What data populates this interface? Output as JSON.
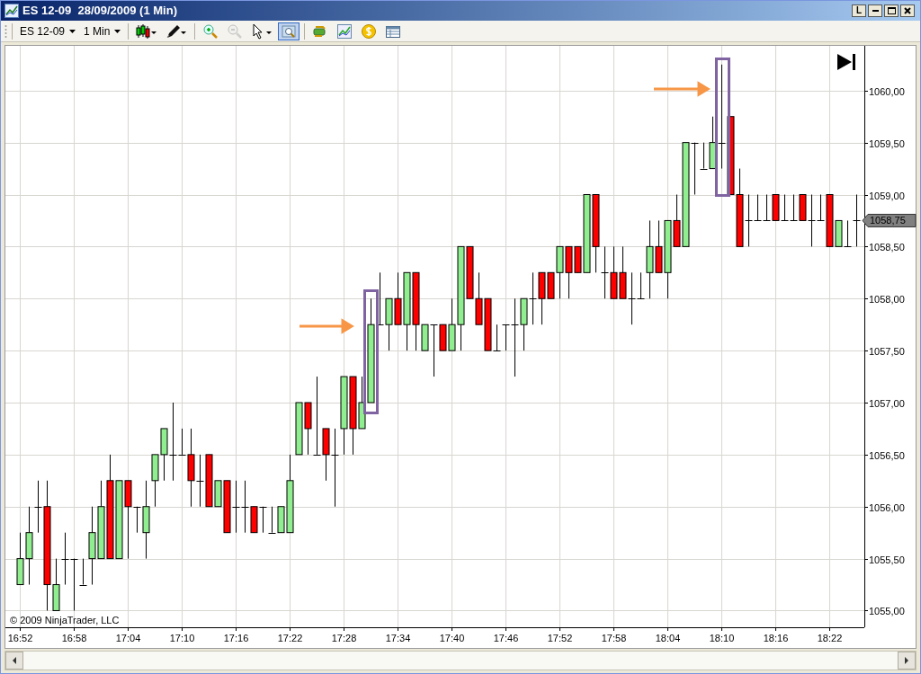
{
  "window": {
    "title": "ES 12-09  28/09/2009 (1 Min)",
    "buttons": [
      "L"
    ]
  },
  "toolbar": {
    "instrument": "ES 12-09",
    "interval": "1 Min",
    "tools": [
      {
        "kind": "bar-style",
        "selected": false,
        "disabled": false
      },
      {
        "kind": "draw",
        "selected": false,
        "disabled": false
      },
      {
        "kind": "zoom-in",
        "selected": false,
        "disabled": false
      },
      {
        "kind": "zoom-out",
        "selected": false,
        "disabled": true
      },
      {
        "kind": "pointer",
        "selected": false,
        "disabled": false
      },
      {
        "kind": "zoom-box",
        "selected": true,
        "disabled": false
      },
      {
        "kind": "data-series",
        "selected": false,
        "disabled": false
      },
      {
        "kind": "chart-style",
        "selected": false,
        "disabled": false
      },
      {
        "kind": "dollar",
        "selected": false,
        "disabled": false
      },
      {
        "kind": "data-box",
        "selected": false,
        "disabled": false
      }
    ]
  },
  "chart": {
    "last_price": "1058,75",
    "copyright": "© 2009 NinjaTrader, LLC",
    "chart_data": {
      "type": "candlestick",
      "grid": true,
      "ylim": [
        1054.84,
        1060.43
      ],
      "categories": [
        "16:52",
        null,
        null,
        null,
        null,
        null,
        "16:58",
        null,
        null,
        null,
        null,
        null,
        "17:04",
        null,
        null,
        null,
        null,
        null,
        "17:10",
        null,
        null,
        null,
        null,
        null,
        "17:16",
        null,
        null,
        null,
        null,
        null,
        "17:22",
        null,
        null,
        null,
        null,
        null,
        "17:28",
        null,
        null,
        null,
        null,
        null,
        "17:34",
        null,
        null,
        null,
        null,
        null,
        "17:40",
        null,
        null,
        null,
        null,
        null,
        "17:46",
        null,
        null,
        null,
        null,
        null,
        "17:52",
        null,
        null,
        null,
        null,
        null,
        "17:58",
        null,
        null,
        null,
        null,
        null,
        "18:04",
        null,
        null,
        null,
        null,
        null,
        "18:10",
        null,
        null,
        null,
        null,
        null,
        "18:16",
        null,
        null,
        null,
        null,
        null,
        "18:22",
        null,
        null,
        null
      ],
      "ohlc": [
        [
          1055.25,
          1055.75,
          1055.25,
          1055.5
        ],
        [
          1055.5,
          1056,
          1055.25,
          1055.75
        ],
        [
          1056,
          1056.25,
          1055.75,
          1056
        ],
        [
          1056,
          1056.25,
          1055,
          1055.25
        ],
        [
          1055,
          1055.5,
          1055,
          1055.25
        ],
        [
          1055.5,
          1055.75,
          1055.25,
          1055.5
        ],
        [
          1055.5,
          1055.5,
          1055,
          1055.5
        ],
        [
          1055.25,
          1055.5,
          1055.25,
          1055.25
        ],
        [
          1055.5,
          1056,
          1055.25,
          1055.75
        ],
        [
          1055.5,
          1056.25,
          1055.5,
          1056
        ],
        [
          1056.25,
          1056.5,
          1055.5,
          1055.5
        ],
        [
          1055.5,
          1056.25,
          1055.5,
          1056.25
        ],
        [
          1056.25,
          1056.25,
          1055.5,
          1056
        ],
        [
          1056,
          1056,
          1055.75,
          1056
        ],
        [
          1055.75,
          1056.25,
          1055.5,
          1056
        ],
        [
          1056.25,
          1056.5,
          1056,
          1056.5
        ],
        [
          1056.5,
          1056.75,
          1056.25,
          1056.75
        ],
        [
          1056.5,
          1057,
          1056.25,
          1056.5
        ],
        [
          1056.5,
          1056.75,
          1056.5,
          1056.5
        ],
        [
          1056.5,
          1056.75,
          1056,
          1056.25
        ],
        [
          1056.25,
          1056.5,
          1056,
          1056.25
        ],
        [
          1056.5,
          1056.5,
          1056,
          1056
        ],
        [
          1056,
          1056.25,
          1056,
          1056.25
        ],
        [
          1056.25,
          1056.25,
          1055.75,
          1055.75
        ],
        [
          1056,
          1056.25,
          1055.75,
          1056
        ],
        [
          1056,
          1056.25,
          1055.75,
          1056
        ],
        [
          1056,
          1056,
          1055.75,
          1055.75
        ],
        [
          1056,
          1056,
          1055.75,
          1056
        ],
        [
          1055.75,
          1056,
          1055.75,
          1055.75
        ],
        [
          1055.75,
          1056,
          1055.75,
          1056
        ],
        [
          1055.75,
          1056.5,
          1055.75,
          1056.25
        ],
        [
          1056.5,
          1057,
          1056.5,
          1057
        ],
        [
          1057,
          1057,
          1056.5,
          1056.75
        ],
        [
          1056.5,
          1057.25,
          1056.5,
          1056.5
        ],
        [
          1056.75,
          1056.75,
          1056.25,
          1056.5
        ],
        [
          1056.5,
          1056.75,
          1056,
          1056.5
        ],
        [
          1056.75,
          1057.25,
          1056.5,
          1057.25
        ],
        [
          1057.25,
          1057.25,
          1056.5,
          1056.75
        ],
        [
          1056.75,
          1057.25,
          1056.75,
          1057
        ],
        [
          1057,
          1058,
          1057,
          1057.75
        ],
        [
          1057.75,
          1058.25,
          1057.75,
          1057.75
        ],
        [
          1057.75,
          1058,
          1057.5,
          1058
        ],
        [
          1058,
          1058.25,
          1057.75,
          1057.75
        ],
        [
          1057.75,
          1058.25,
          1057.5,
          1058.25
        ],
        [
          1058.25,
          1058.25,
          1057.5,
          1057.75
        ],
        [
          1057.5,
          1057.75,
          1057.5,
          1057.75
        ],
        [
          1057.75,
          1057.75,
          1057.25,
          1057.75
        ],
        [
          1057.75,
          1057.75,
          1057.5,
          1057.5
        ],
        [
          1057.5,
          1058,
          1057.5,
          1057.75
        ],
        [
          1057.75,
          1058.5,
          1057.5,
          1058.5
        ],
        [
          1058.5,
          1058.5,
          1058,
          1058
        ],
        [
          1058,
          1058.25,
          1057.75,
          1057.75
        ],
        [
          1058,
          1058,
          1057.5,
          1057.5
        ],
        [
          1057.5,
          1057.75,
          1057.5,
          1057.5
        ],
        [
          1057.75,
          1057.75,
          1057.5,
          1057.75
        ],
        [
          1057.75,
          1058,
          1057.25,
          1057.75
        ],
        [
          1057.75,
          1058,
          1057.5,
          1058
        ],
        [
          1058,
          1058.25,
          1057.75,
          1058
        ],
        [
          1058.25,
          1058.25,
          1057.75,
          1058
        ],
        [
          1058.25,
          1058.25,
          1058,
          1058
        ],
        [
          1058.25,
          1058.5,
          1058,
          1058.5
        ],
        [
          1058.5,
          1058.5,
          1058,
          1058.25
        ],
        [
          1058.5,
          1058.5,
          1058.25,
          1058.25
        ],
        [
          1058.25,
          1059,
          1058.25,
          1059
        ],
        [
          1059,
          1059,
          1058.25,
          1058.5
        ],
        [
          1058.25,
          1058.5,
          1058,
          1058.25
        ],
        [
          1058.25,
          1058.5,
          1058,
          1058
        ],
        [
          1058.25,
          1058.5,
          1058,
          1058
        ],
        [
          1058,
          1058.25,
          1057.75,
          1058
        ],
        [
          1058,
          1058.25,
          1058,
          1058
        ],
        [
          1058.25,
          1058.75,
          1058,
          1058.5
        ],
        [
          1058.5,
          1058.75,
          1058.25,
          1058.25
        ],
        [
          1058.25,
          1058.75,
          1058,
          1058.75
        ],
        [
          1058.75,
          1059,
          1058.5,
          1058.5
        ],
        [
          1058.5,
          1059.5,
          1058.5,
          1059.5
        ],
        [
          1059.5,
          1059.5,
          1059,
          1059.5
        ],
        [
          1059.25,
          1059.5,
          1059.25,
          1059.25
        ],
        [
          1059.25,
          1059.75,
          1059.25,
          1059.5
        ],
        [
          1059.5,
          1060.25,
          1059.25,
          1059.5
        ],
        [
          1059.75,
          1059.75,
          1059,
          1059
        ],
        [
          1059,
          1059.25,
          1058.5,
          1058.5
        ],
        [
          1058.75,
          1059,
          1058.5,
          1058.75
        ],
        [
          1058.75,
          1059,
          1058.75,
          1058.75
        ],
        [
          1058.75,
          1059,
          1058.75,
          1058.75
        ],
        [
          1059,
          1059,
          1058.75,
          1058.75
        ],
        [
          1058.75,
          1059,
          1058.75,
          1058.75
        ],
        [
          1058.75,
          1059,
          1058.75,
          1058.75
        ],
        [
          1059,
          1059,
          1058.75,
          1058.75
        ],
        [
          1058.75,
          1059,
          1058.5,
          1058.75
        ],
        [
          1058.75,
          1059,
          1058.75,
          1058.75
        ],
        [
          1059,
          1059,
          1058.5,
          1058.5
        ],
        [
          1058.5,
          1058.75,
          1058.5,
          1058.75
        ],
        [
          1058.5,
          1058.75,
          1058.5,
          1058.5
        ],
        [
          1058.75,
          1059,
          1058.5,
          1058.75
        ]
      ],
      "yticks": [
        {
          "value": 1060,
          "label": "1060,00"
        },
        {
          "value": 1059.5,
          "label": "1059,50"
        },
        {
          "value": 1059,
          "label": "1059,00"
        },
        {
          "value": 1058.5,
          "label": "1058,50"
        },
        {
          "value": 1058,
          "label": "1058,00"
        },
        {
          "value": 1057.5,
          "label": "1057,50"
        },
        {
          "value": 1057,
          "label": "1057,00"
        },
        {
          "value": 1056.5,
          "label": "1056,50"
        },
        {
          "value": 1056,
          "label": "1056,00"
        },
        {
          "value": 1055.5,
          "label": "1055,50"
        },
        {
          "value": 1055,
          "label": "1055,00"
        }
      ]
    }
  }
}
